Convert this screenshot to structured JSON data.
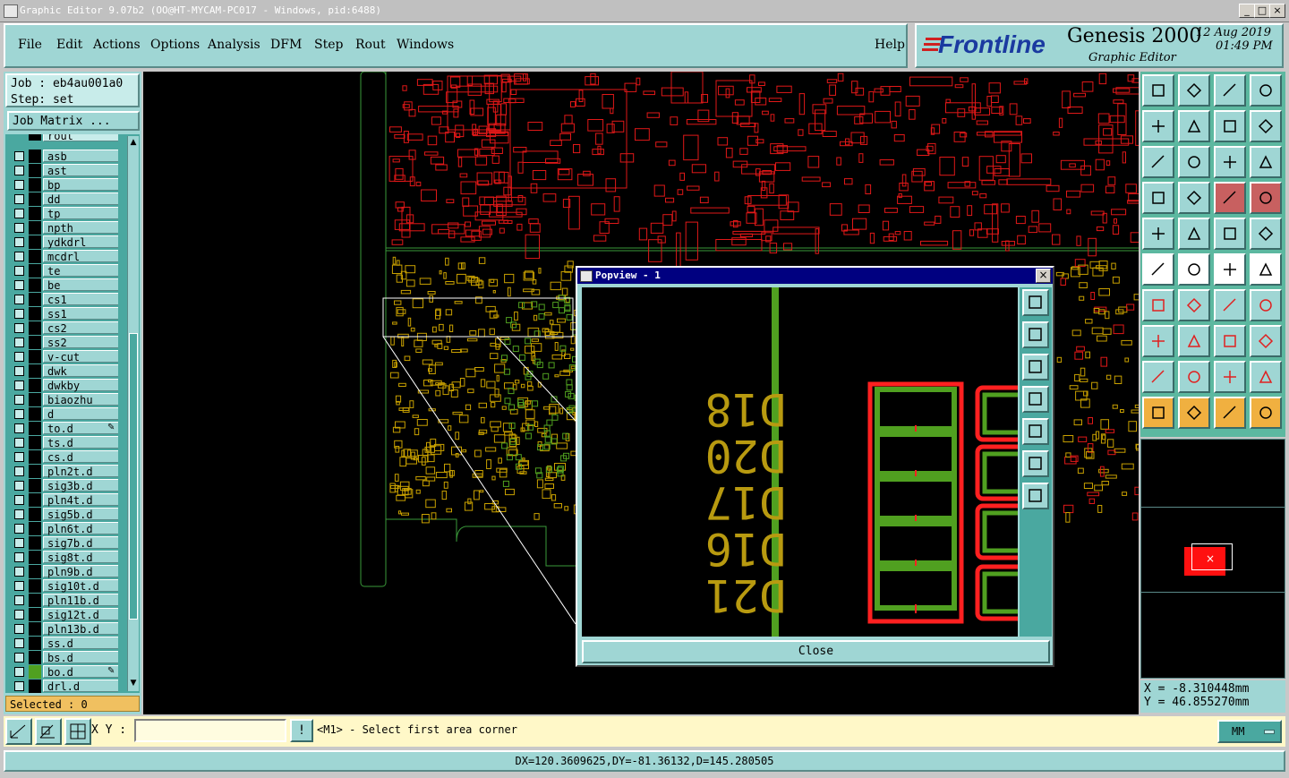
{
  "window": {
    "title": "Graphic Editor 9.07b2 (OO@HT-MYCAM-PC017 - Windows, pid:6488)",
    "min_label": "_",
    "max_label": "□",
    "close_label": "×"
  },
  "menu": {
    "items": [
      "File",
      "Edit",
      "Actions",
      "Options",
      "Analysis",
      "DFM",
      "Step",
      "Rout",
      "Windows"
    ],
    "help": "Help"
  },
  "brand": {
    "logo": "Frontline",
    "product": "Genesis 2000",
    "subtitle": "Graphic Editor",
    "date": "12 Aug 2019",
    "time": "01:49 PM"
  },
  "job": {
    "job_label": "Job : eb4au001a0",
    "step_label": "Step: set",
    "matrix_button": "Job Matrix ..."
  },
  "layers": {
    "partial_top": "rout",
    "items": [
      {
        "name": "asb",
        "flag": ""
      },
      {
        "name": "ast",
        "flag": ""
      },
      {
        "name": "bp",
        "flag": ""
      },
      {
        "name": "dd",
        "flag": ""
      },
      {
        "name": "tp",
        "flag": ""
      },
      {
        "name": "npth",
        "flag": ""
      },
      {
        "name": "ydkdrl",
        "flag": ""
      },
      {
        "name": "mcdrl",
        "flag": ""
      },
      {
        "name": "te",
        "flag": ""
      },
      {
        "name": "be",
        "flag": ""
      },
      {
        "name": "cs1",
        "flag": ""
      },
      {
        "name": "ss1",
        "flag": ""
      },
      {
        "name": "cs2",
        "flag": ""
      },
      {
        "name": "ss2",
        "flag": ""
      },
      {
        "name": "v-cut",
        "flag": ""
      },
      {
        "name": "dwk",
        "flag": ""
      },
      {
        "name": "dwkby",
        "flag": ""
      },
      {
        "name": "biaozhu",
        "flag": ""
      },
      {
        "name": "d",
        "flag": ""
      },
      {
        "name": "to.d",
        "flag": "✎"
      },
      {
        "name": "ts.d",
        "flag": ""
      },
      {
        "name": "cs.d",
        "flag": ""
      },
      {
        "name": "pln2t.d",
        "flag": ""
      },
      {
        "name": "sig3b.d",
        "flag": ""
      },
      {
        "name": "pln4t.d",
        "flag": ""
      },
      {
        "name": "sig5b.d",
        "flag": ""
      },
      {
        "name": "pln6t.d",
        "flag": ""
      },
      {
        "name": "sig7b.d",
        "flag": ""
      },
      {
        "name": "sig8t.d",
        "flag": ""
      },
      {
        "name": "pln9b.d",
        "flag": ""
      },
      {
        "name": "sig10t.d",
        "flag": ""
      },
      {
        "name": "pln11b.d",
        "flag": ""
      },
      {
        "name": "sig12t.d",
        "flag": ""
      },
      {
        "name": "pln13b.d",
        "flag": ""
      },
      {
        "name": "ss.d",
        "flag": ""
      },
      {
        "name": "bs.d",
        "flag": ""
      },
      {
        "name": "bo.d",
        "flag": "✎"
      }
    ],
    "partial_bottom": "drl.d",
    "selected": "Selected : 0"
  },
  "popview": {
    "title": "Popview - 1",
    "close_x": "×",
    "close_button": "Close",
    "labels": [
      "D18",
      "D20",
      "D17",
      "D16",
      "D21"
    ]
  },
  "coords": {
    "x": "X = -8.310448mm",
    "y": "Y = 46.855270mm"
  },
  "command": {
    "xy_label": "X Y :",
    "xy_value": "",
    "bang": "!",
    "prompt": "<M1> - Select first area corner",
    "units": "MM"
  },
  "status": {
    "measure": "DX=120.3609625,DY=-81.36132,D=145.280505"
  },
  "colors": {
    "panel": "#9fd6d4",
    "toolbox": "#5cb8a0",
    "red_layer": "#e01818",
    "yellow_layer": "#c8a000",
    "green_layer": "#50a020",
    "outline": "#3a9a3a"
  }
}
